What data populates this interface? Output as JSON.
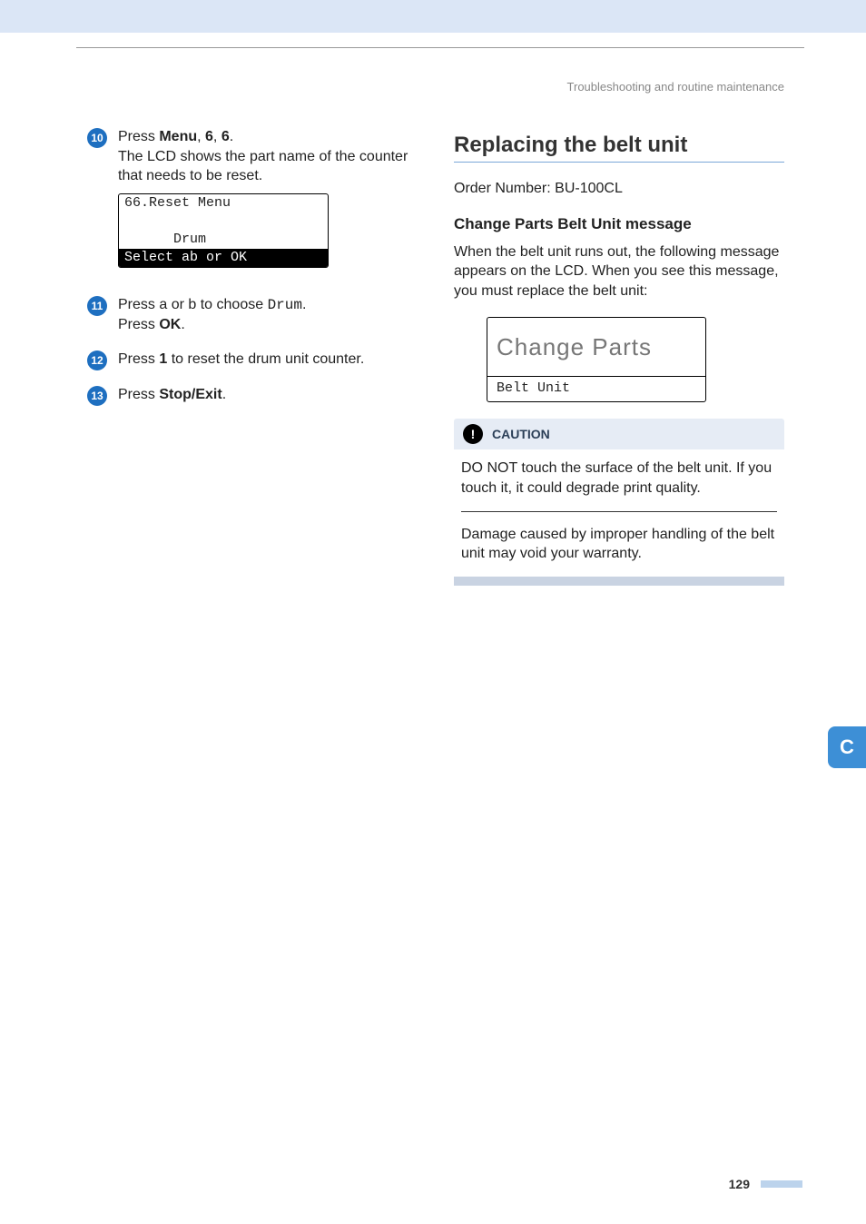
{
  "running_head": "Troubleshooting and routine maintenance",
  "left": {
    "steps": {
      "s10": {
        "num": "10",
        "prefix": "Press ",
        "b1": "Menu",
        "sep1": ", ",
        "b2": "6",
        "sep2": ", ",
        "b3": "6",
        "suffix": ".",
        "line2": "The LCD shows the part name of the counter that needs to be reset."
      },
      "lcd": {
        "r1": "66.Reset Menu",
        "r2": " ",
        "r3": "      Drum",
        "r4": "Select ab or OK"
      },
      "s11": {
        "num": "11",
        "prefix": "Press ",
        "arrow1": "a",
        "mid": " or ",
        "arrow2": "b",
        "mid2": " to choose ",
        "mono": "Drum",
        "suffix": ".",
        "line2a": "Press ",
        "line2b": "OK",
        "line2c": "."
      },
      "s12": {
        "num": "12",
        "prefix": "Press ",
        "b1": "1",
        "suffix": " to reset the drum unit counter."
      },
      "s13": {
        "num": "13",
        "prefix": "Press ",
        "b1": "Stop/Exit",
        "suffix": "."
      }
    }
  },
  "right": {
    "section_title": "Replacing the belt unit",
    "order_line": "Order Number: BU-100CL",
    "subhead": "Change Parts Belt Unit message",
    "intro": "When the belt unit runs out, the following message appears on the LCD. When you see this message, you must replace the belt unit:",
    "lcd_big": {
      "top": "Change Parts",
      "bot": "Belt Unit"
    },
    "caution": {
      "label": "CAUTION",
      "p1": "DO NOT touch the surface of the belt unit. If you touch it, it could degrade print quality.",
      "p2": "Damage caused by improper handling of the belt unit may void your warranty."
    }
  },
  "side_tab": "C",
  "page_number": "129"
}
